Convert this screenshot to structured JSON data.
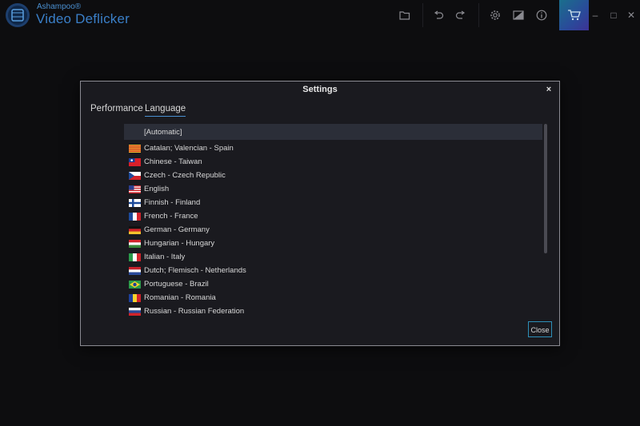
{
  "app": {
    "brand_small": "Ashampoo®",
    "brand_name": "Video Deflicker"
  },
  "toolbar": {
    "icons": [
      "folder-icon",
      "undo-icon",
      "redo-icon",
      "gear-icon",
      "image-icon",
      "info-icon",
      "cart-icon"
    ]
  },
  "window_controls": {
    "minimize": "–",
    "maximize": "□",
    "close": "✕"
  },
  "dialog": {
    "title": "Settings",
    "close_glyph": "×",
    "tabs": [
      {
        "label": "Performance",
        "active": false
      },
      {
        "label": "Language",
        "active": true
      }
    ],
    "languages": [
      {
        "label": "[Automatic]",
        "flag": null,
        "selected": true
      },
      {
        "label": "Catalan; Valencian - Spain",
        "flag": "catalonia"
      },
      {
        "label": "Chinese - Taiwan",
        "flag": "taiwan"
      },
      {
        "label": "Czech - Czech Republic",
        "flag": "czech"
      },
      {
        "label": "English",
        "flag": "usa"
      },
      {
        "label": "Finnish - Finland",
        "flag": "finland"
      },
      {
        "label": "French - France",
        "flag": "france"
      },
      {
        "label": "German - Germany",
        "flag": "germany"
      },
      {
        "label": "Hungarian - Hungary",
        "flag": "hungary"
      },
      {
        "label": "Italian - Italy",
        "flag": "italy"
      },
      {
        "label": "Dutch; Flemisch - Netherlands",
        "flag": "netherlands"
      },
      {
        "label": "Portuguese - Brazil",
        "flag": "brazil"
      },
      {
        "label": "Romanian - Romania",
        "flag": "romania"
      },
      {
        "label": "Russian - Russian Federation",
        "flag": "russia"
      }
    ],
    "close_label": "Close"
  },
  "colors": {
    "accent": "#3a7fc8",
    "button_border": "#2d8fb8",
    "selected_row": "#2b2e38"
  }
}
